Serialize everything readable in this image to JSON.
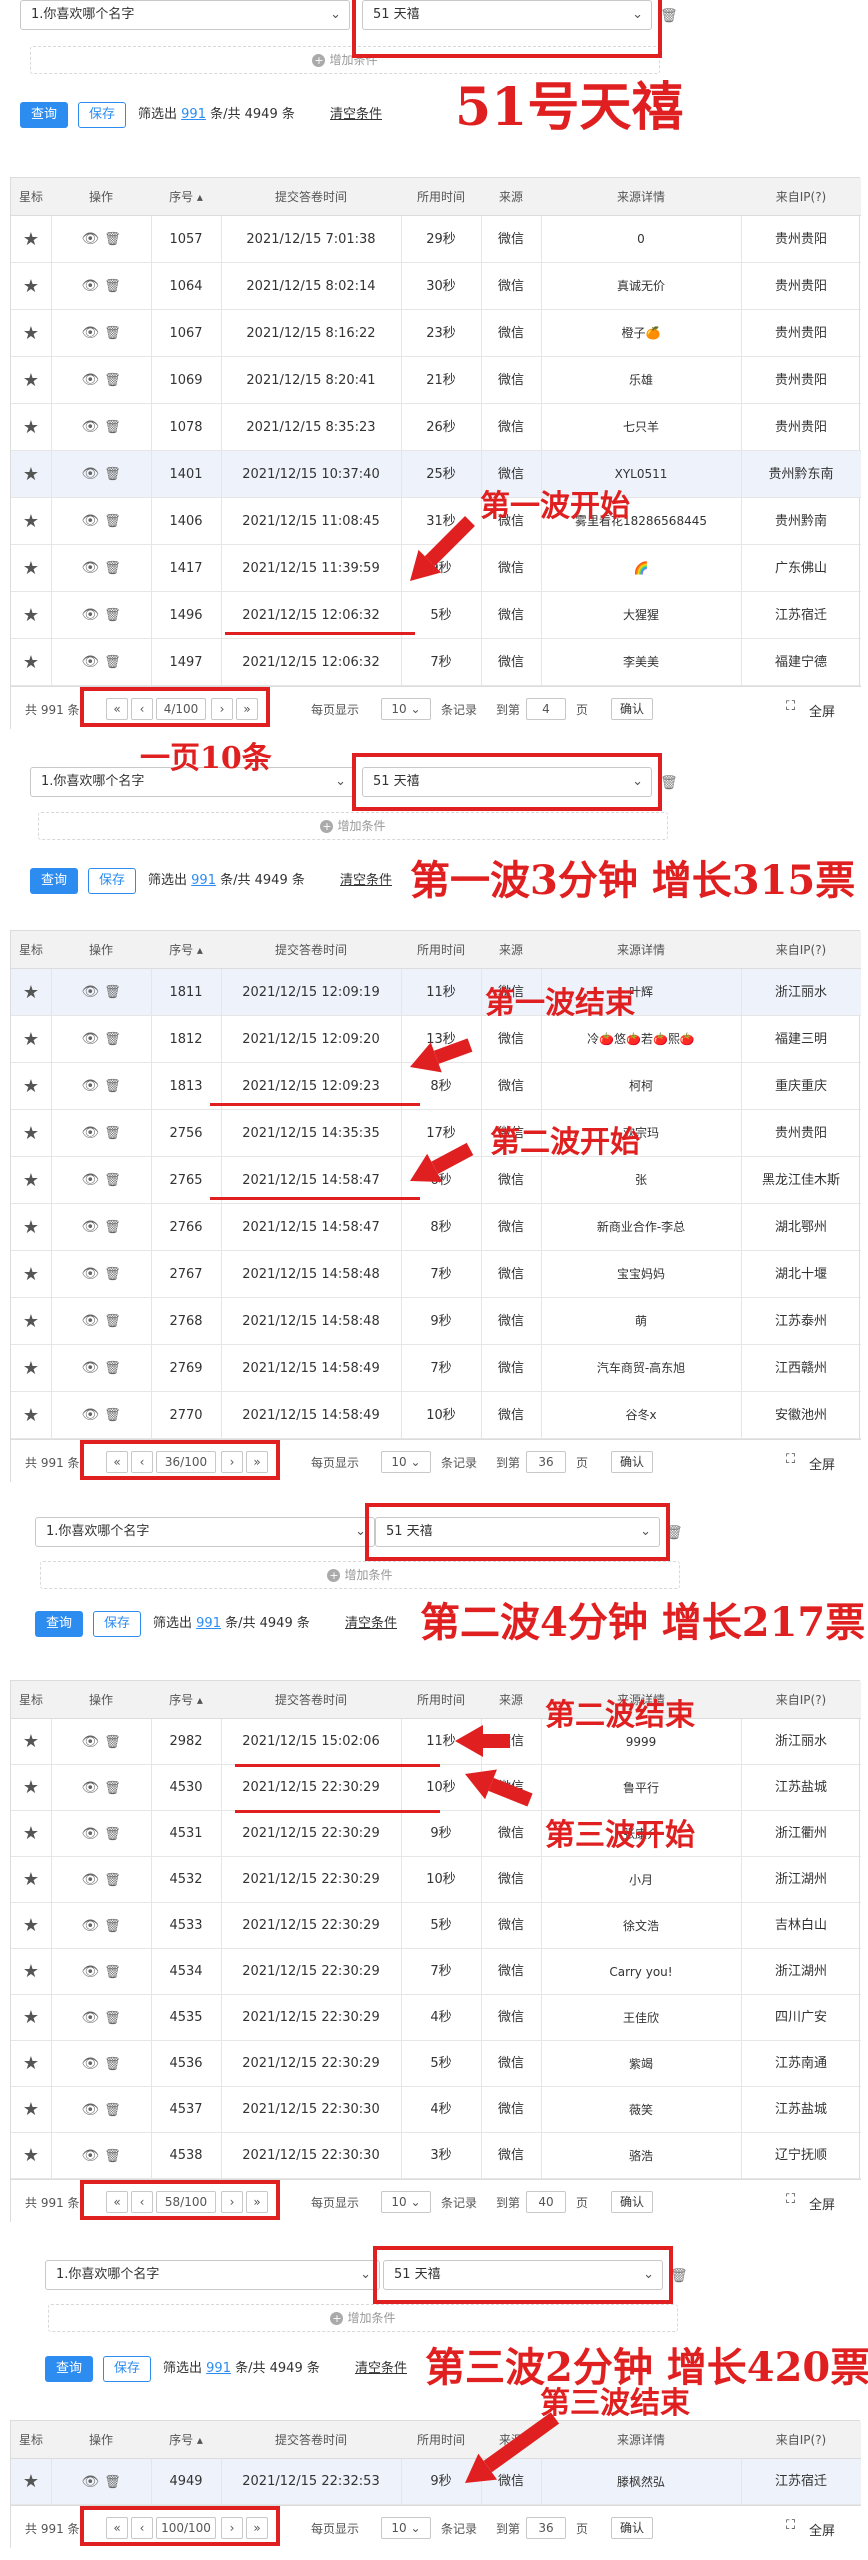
{
  "filter": {
    "question": "1.你喜欢哪个名字",
    "answer": "51 天禧",
    "add_condition": "增加条件",
    "query": "查询",
    "save": "保存",
    "filter_prefix": "筛选出",
    "filter_count": "991",
    "filter_suffix": "条/共 4949 条",
    "clear": "清空条件"
  },
  "columns": [
    "星标",
    "操作",
    "序号 ▴",
    "提交答卷时间",
    "所用时间",
    "来源",
    "来源详情",
    "来自IP(?)"
  ],
  "pager": {
    "total": "共 991 条",
    "first": "«",
    "prev": "‹",
    "next": "›",
    "last": "»",
    "per_page_label": "每页显示",
    "per_page": "10",
    "records": "条记录",
    "goto": "到第",
    "page_unit": "页",
    "confirm": "确认",
    "fullscreen": "全屏"
  },
  "icons": {
    "star": "star-icon",
    "view": "eye-icon",
    "delete": "trash-icon",
    "fullscreen": "fullscreen-icon",
    "add": "plus-circle-icon"
  },
  "colors": {
    "annotation": "#e02020",
    "primary": "#2d8cf0",
    "highlight_row": "#eef3fb"
  },
  "sections": [
    {
      "caption": "51号天禧",
      "page": "4/100",
      "goto_value": "4",
      "rows": [
        [
          "1057",
          "2021/12/15 7:01:38",
          "29秒",
          "微信",
          "0",
          "贵州贵阳"
        ],
        [
          "1064",
          "2021/12/15 8:02:14",
          "30秒",
          "微信",
          "真诚无价",
          "贵州贵阳"
        ],
        [
          "1067",
          "2021/12/15 8:16:22",
          "23秒",
          "微信",
          "橙子🍊",
          "贵州贵阳"
        ],
        [
          "1069",
          "2021/12/15 8:20:41",
          "21秒",
          "微信",
          "乐雄",
          "贵州贵阳"
        ],
        [
          "1078",
          "2021/12/15 8:35:23",
          "26秒",
          "微信",
          "七只羊",
          "贵州贵阳"
        ],
        [
          "1401",
          "2021/12/15 10:37:40",
          "25秒",
          "微信",
          "XYL0511",
          "贵州黔东南"
        ],
        [
          "1406",
          "2021/12/15 11:08:45",
          "31秒",
          "微信",
          "雾里看花18286568445",
          "贵州黔南"
        ],
        [
          "1417",
          "2021/12/15 11:39:59",
          "9秒",
          "微信",
          "🌈",
          "广东佛山"
        ],
        [
          "1496",
          "2021/12/15 12:06:32",
          "5秒",
          "微信",
          "大猩猩",
          "江苏宿迁"
        ],
        [
          "1497",
          "2021/12/15 12:06:32",
          "7秒",
          "微信",
          "李美美",
          "福建宁德"
        ]
      ],
      "labels": [
        "第一波开始",
        "一页10条"
      ]
    },
    {
      "caption": "第一波3分钟 增长315票",
      "page": "36/100",
      "goto_value": "36",
      "rows": [
        [
          "1811",
          "2021/12/15 12:09:19",
          "11秒",
          "微信",
          "叶辉",
          "浙江丽水"
        ],
        [
          "1812",
          "2021/12/15 12:09:20",
          "13秒",
          "微信",
          "冷🍅悠🍅若🍅熙🍅",
          "福建三明"
        ],
        [
          "1813",
          "2021/12/15 12:09:23",
          "8秒",
          "微信",
          "柯柯",
          "重庆重庆"
        ],
        [
          "2756",
          "2021/12/15 14:35:35",
          "17秒",
          "微信",
          "欢宗玛",
          "贵州贵阳"
        ],
        [
          "2765",
          "2021/12/15 14:58:47",
          "6秒",
          "微信",
          "张",
          "黑龙江佳木斯"
        ],
        [
          "2766",
          "2021/12/15 14:58:47",
          "8秒",
          "微信",
          "新商业合作-李总",
          "湖北鄂州"
        ],
        [
          "2767",
          "2021/12/15 14:58:48",
          "7秒",
          "微信",
          "宝宝妈妈",
          "湖北十堰"
        ],
        [
          "2768",
          "2021/12/15 14:58:48",
          "9秒",
          "微信",
          "萌",
          "江苏泰州"
        ],
        [
          "2769",
          "2021/12/15 14:58:49",
          "7秒",
          "微信",
          "汽车商贸-高东旭",
          "江西赣州"
        ],
        [
          "2770",
          "2021/12/15 14:58:49",
          "10秒",
          "微信",
          "谷冬x",
          "安徽池州"
        ]
      ],
      "labels": [
        "第一波结束",
        "第二波开始"
      ]
    },
    {
      "caption": "第二波4分钟 增长217票",
      "page": "58/100",
      "goto_value": "40",
      "rows": [
        [
          "2982",
          "2021/12/15 15:02:06",
          "11秒",
          "微信",
          "9999",
          "浙江丽水"
        ],
        [
          "4530",
          "2021/12/15 22:30:29",
          "10秒",
          "微信",
          "鲁平行",
          "江苏盐城"
        ],
        [
          "4531",
          "2021/12/15 22:30:29",
          "9秒",
          "微信",
          "张康介",
          "浙江衢州"
        ],
        [
          "4532",
          "2021/12/15 22:30:29",
          "10秒",
          "微信",
          "小月",
          "浙江湖州"
        ],
        [
          "4533",
          "2021/12/15 22:30:29",
          "5秒",
          "微信",
          "徐文浩",
          "吉林白山"
        ],
        [
          "4534",
          "2021/12/15 22:30:29",
          "7秒",
          "微信",
          "Carry you!",
          "浙江湖州"
        ],
        [
          "4535",
          "2021/12/15 22:30:29",
          "4秒",
          "微信",
          "王佳欣",
          "四川广安"
        ],
        [
          "4536",
          "2021/12/15 22:30:29",
          "5秒",
          "微信",
          "紫竭",
          "江苏南通"
        ],
        [
          "4537",
          "2021/12/15 22:30:30",
          "4秒",
          "微信",
          "薇笑",
          "江苏盐城"
        ],
        [
          "4538",
          "2021/12/15 22:30:30",
          "3秒",
          "微信",
          "骆浩",
          "辽宁抚顺"
        ]
      ],
      "labels": [
        "第二波结束",
        "第三波开始"
      ]
    },
    {
      "caption": "第三波2分钟 增长420票",
      "page": "100/100",
      "goto_value": "36",
      "rows": [
        [
          "4949",
          "2021/12/15 22:32:53",
          "9秒",
          "微信",
          "滕枫然弘",
          "江苏宿迁"
        ]
      ],
      "labels": [
        "第三波结束"
      ]
    }
  ]
}
